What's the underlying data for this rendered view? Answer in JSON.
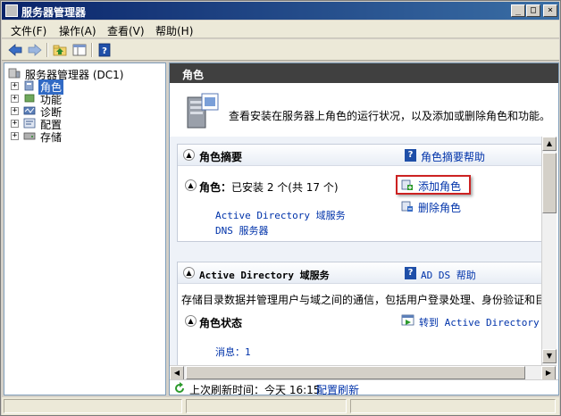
{
  "window": {
    "title": "服务器管理器",
    "minimize_glyph": "_",
    "maximize_glyph": "□",
    "close_glyph": "×"
  },
  "menu": {
    "items": [
      "文件(F)",
      "操作(A)",
      "查看(V)",
      "帮助(H)"
    ]
  },
  "toolbar": {
    "icons": [
      "back-arrow-icon",
      "forward-arrow-icon",
      "up-folder-icon",
      "show-hide-tree-icon",
      "help-icon"
    ]
  },
  "tree": {
    "root": "服务器管理器 (DC1)",
    "items": [
      {
        "label": "角色",
        "icon": "roles-icon",
        "selected": true
      },
      {
        "label": "功能",
        "icon": "features-icon",
        "selected": false
      },
      {
        "label": "诊断",
        "icon": "diagnostics-icon",
        "selected": false
      },
      {
        "label": "配置",
        "icon": "configuration-icon",
        "selected": false
      },
      {
        "label": "存储",
        "icon": "storage-icon",
        "selected": false
      }
    ],
    "expand_glyph": "+"
  },
  "main": {
    "header": "角色",
    "intro": "查看安装在服务器上角色的运行状况，以及添加或删除角色和功能。",
    "roles_summary": {
      "title": "角色摘要",
      "help_link": "角色摘要帮助",
      "count_label": "角色：",
      "count_text": "已安装 2 个(共 17 个)",
      "roles": [
        "Active Directory 域服务",
        "DNS 服务器"
      ],
      "add_link": "添加角色",
      "remove_link": "删除角色"
    },
    "ad_section": {
      "title": "Active Directory 域服务",
      "help_link": "AD DS 帮助",
      "description": "存储目录数据并管理用户与域之间的通信，包括用户登录处理、身份验证和目录搜",
      "status_title": "角色状态",
      "goto_link": "转到 Active Directory 域",
      "messages_label": "消息：1"
    },
    "refresh": {
      "label": "上次刷新时间：今天 16:15",
      "link": "配置刷新"
    }
  },
  "colors": {
    "accent_highlight": "#cc2222",
    "link": "#0033aa",
    "header_bg": "#404040",
    "selected_bg": "#316ac5"
  }
}
